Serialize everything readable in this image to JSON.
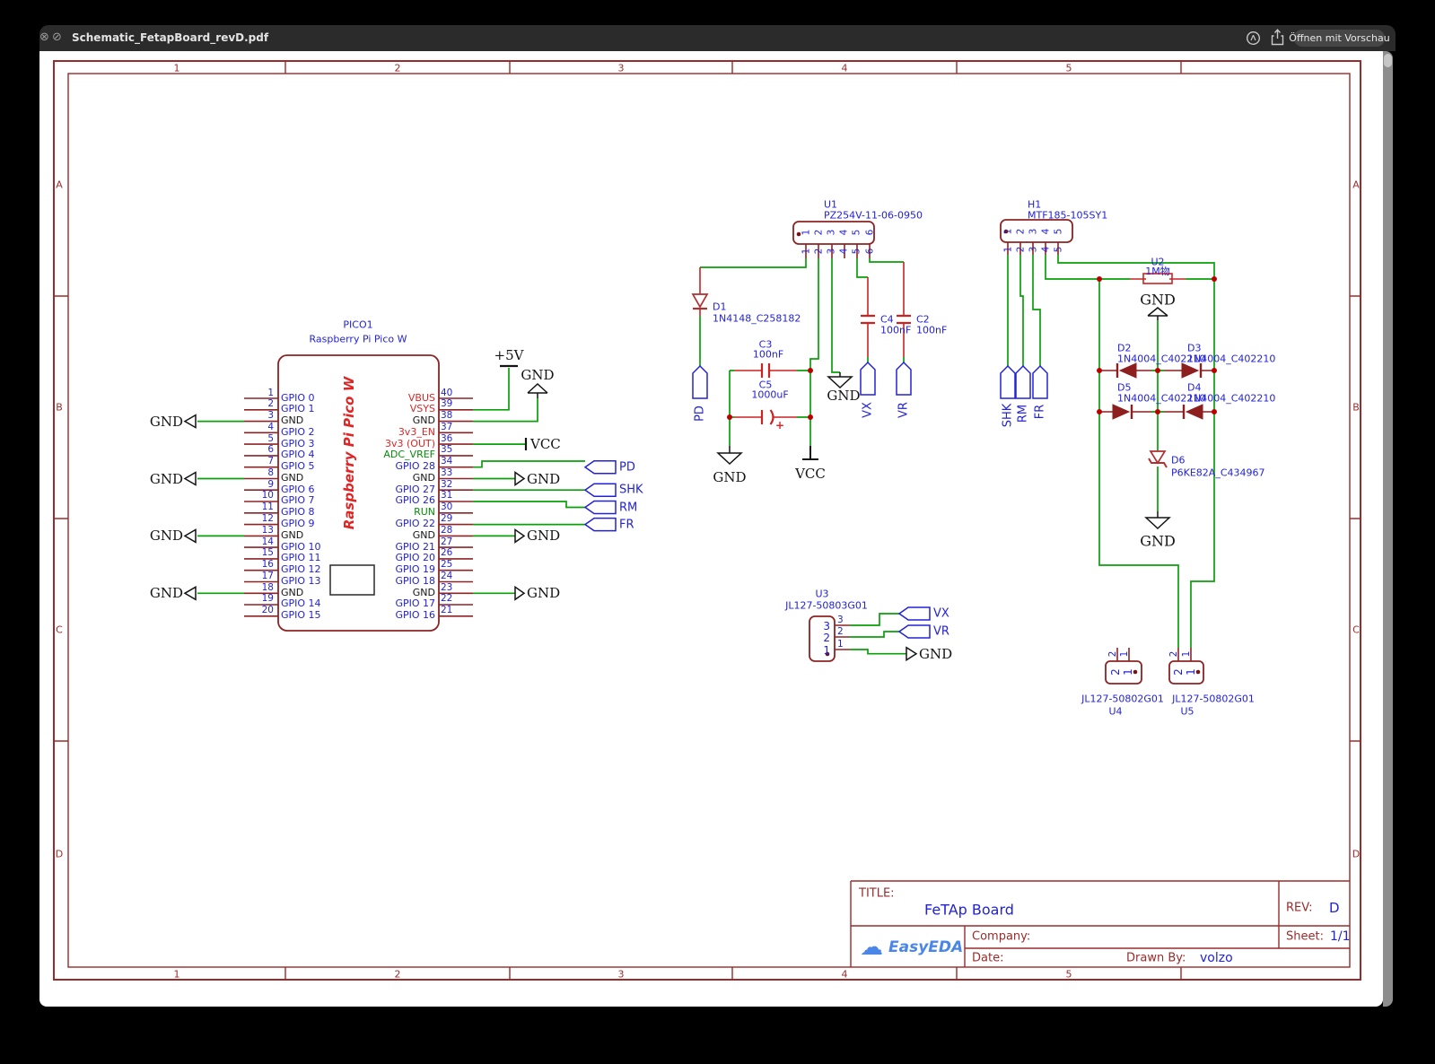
{
  "window": {
    "title": "Schematic_FetapBoard_revD.pdf",
    "open_button": "Öffnen mit Vorschau",
    "icon_glyphs": {
      "close": "⊗",
      "blocked": "⊘"
    }
  },
  "frame": {
    "cols": [
      "1",
      "2",
      "3",
      "4",
      "5"
    ],
    "rows": [
      "A",
      "B",
      "C",
      "D"
    ]
  },
  "power": {
    "gnd": "GND",
    "vcc": "VCC",
    "p5v": "+5V"
  },
  "flags": {
    "pd": "PD",
    "shk": "SHK",
    "rm": "RM",
    "fr": "FR",
    "vx": "VX",
    "vr": "VR"
  },
  "pico": {
    "refdes": "PICO1",
    "part": "Raspberry Pi Pico W",
    "body_label": "Raspberry Pi Pico W",
    "left": [
      {
        "n": "1",
        "name": "GPIO 0",
        "cls": "blue"
      },
      {
        "n": "2",
        "name": "GPIO 1",
        "cls": "blue"
      },
      {
        "n": "3",
        "name": "GND",
        "cls": "black"
      },
      {
        "n": "4",
        "name": "GPIO 2",
        "cls": "blue"
      },
      {
        "n": "5",
        "name": "GPIO 3",
        "cls": "blue"
      },
      {
        "n": "6",
        "name": "GPIO 4",
        "cls": "blue"
      },
      {
        "n": "7",
        "name": "GPIO 5",
        "cls": "blue"
      },
      {
        "n": "8",
        "name": "GND",
        "cls": "black"
      },
      {
        "n": "9",
        "name": "GPIO 6",
        "cls": "blue"
      },
      {
        "n": "10",
        "name": "GPIO 7",
        "cls": "blue"
      },
      {
        "n": "11",
        "name": "GPIO 8",
        "cls": "blue"
      },
      {
        "n": "12",
        "name": "GPIO 9",
        "cls": "blue"
      },
      {
        "n": "13",
        "name": "GND",
        "cls": "black"
      },
      {
        "n": "14",
        "name": "GPIO 10",
        "cls": "blue"
      },
      {
        "n": "15",
        "name": "GPIO 11",
        "cls": "blue"
      },
      {
        "n": "16",
        "name": "GPIO 12",
        "cls": "blue"
      },
      {
        "n": "17",
        "name": "GPIO 13",
        "cls": "blue"
      },
      {
        "n": "18",
        "name": "GND",
        "cls": "black"
      },
      {
        "n": "19",
        "name": "GPIO 14",
        "cls": "blue"
      },
      {
        "n": "20",
        "name": "GPIO 15",
        "cls": "blue"
      }
    ],
    "right": [
      {
        "n": "40",
        "name": "VBUS",
        "cls": "red"
      },
      {
        "n": "39",
        "name": "VSYS",
        "cls": "red"
      },
      {
        "n": "38",
        "name": "GND",
        "cls": "black"
      },
      {
        "n": "37",
        "name": "3v3_EN",
        "cls": "red"
      },
      {
        "n": "36",
        "name": "3v3 (OUT)",
        "cls": "red"
      },
      {
        "n": "35",
        "name": "ADC_VREF",
        "cls": "green"
      },
      {
        "n": "34",
        "name": "GPIO 28",
        "cls": "blue"
      },
      {
        "n": "33",
        "name": "GND",
        "cls": "black"
      },
      {
        "n": "32",
        "name": "GPIO 27",
        "cls": "blue"
      },
      {
        "n": "31",
        "name": "GPIO 26",
        "cls": "blue"
      },
      {
        "n": "30",
        "name": "RUN",
        "cls": "green"
      },
      {
        "n": "29",
        "name": "GPIO 22",
        "cls": "blue"
      },
      {
        "n": "28",
        "name": "GND",
        "cls": "black"
      },
      {
        "n": "27",
        "name": "GPIO 21",
        "cls": "blue"
      },
      {
        "n": "26",
        "name": "GPIO 20",
        "cls": "blue"
      },
      {
        "n": "25",
        "name": "GPIO 19",
        "cls": "blue"
      },
      {
        "n": "24",
        "name": "GPIO 18",
        "cls": "blue"
      },
      {
        "n": "23",
        "name": "GND",
        "cls": "black"
      },
      {
        "n": "22",
        "name": "GPIO 17",
        "cls": "blue"
      },
      {
        "n": "21",
        "name": "GPIO 16",
        "cls": "blue"
      }
    ]
  },
  "u1": {
    "refdes": "U1",
    "part": "PZ254V-11-06-0950",
    "pins": [
      "1",
      "2",
      "3",
      "4",
      "5",
      "6"
    ]
  },
  "d1": {
    "refdes": "D1",
    "part": "1N4148_C258182"
  },
  "c3": {
    "refdes": "C3",
    "value": "100nF"
  },
  "c5": {
    "refdes": "C5",
    "value": "1000uF",
    "plus": "+"
  },
  "c4": {
    "refdes": "C4",
    "value": "100nF"
  },
  "c2": {
    "refdes": "C2",
    "value": "100nF"
  },
  "h1": {
    "refdes": "H1",
    "part": "MTF185-105SY1",
    "pins": [
      "1",
      "2",
      "3",
      "4",
      "5"
    ]
  },
  "u2": {
    "refdes": "U2",
    "value": "1M物"
  },
  "d2": {
    "refdes": "D2",
    "part": "1N4004_C402210"
  },
  "d3": {
    "refdes": "D3",
    "part": "1N4004_C402210"
  },
  "d5": {
    "refdes": "D5",
    "part": "1N4004_C402210"
  },
  "d4": {
    "refdes": "D4",
    "part": "1N4004_C402210"
  },
  "d6": {
    "refdes": "D6",
    "part": "P6KE82A_C434967"
  },
  "u3": {
    "refdes": "U3",
    "part": "JL127-50803G01",
    "pins": [
      "3",
      "2",
      "1"
    ]
  },
  "u4": {
    "refdes": "U4",
    "part": "JL127-50802G01",
    "pins": [
      "2",
      "1"
    ]
  },
  "u5": {
    "refdes": "U5",
    "part": "JL127-50802G01",
    "pins": [
      "2",
      "1"
    ]
  },
  "titleblock": {
    "title_label": "TITLE:",
    "title": "FeTAp Board",
    "rev_label": "REV:",
    "rev": "D",
    "company_label": "Company:",
    "sheet_label": "Sheet:",
    "sheet": "1/1",
    "date_label": "Date:",
    "drawn_label": "Drawn By:",
    "drawn_by": "volzo",
    "logo_text": "EasyEDA",
    "logo_icon": "☁"
  },
  "colors": {
    "wire_green": "#0aa00a",
    "component_red": "#8d2323",
    "accent_red": "#cc2222",
    "label_blue": "#2222d8",
    "frame_red": "#9a2b2b",
    "logo_blue": "#4a86e8",
    "titlebar_bg": "#2b2b2b",
    "page_bg": "#ffffff"
  }
}
